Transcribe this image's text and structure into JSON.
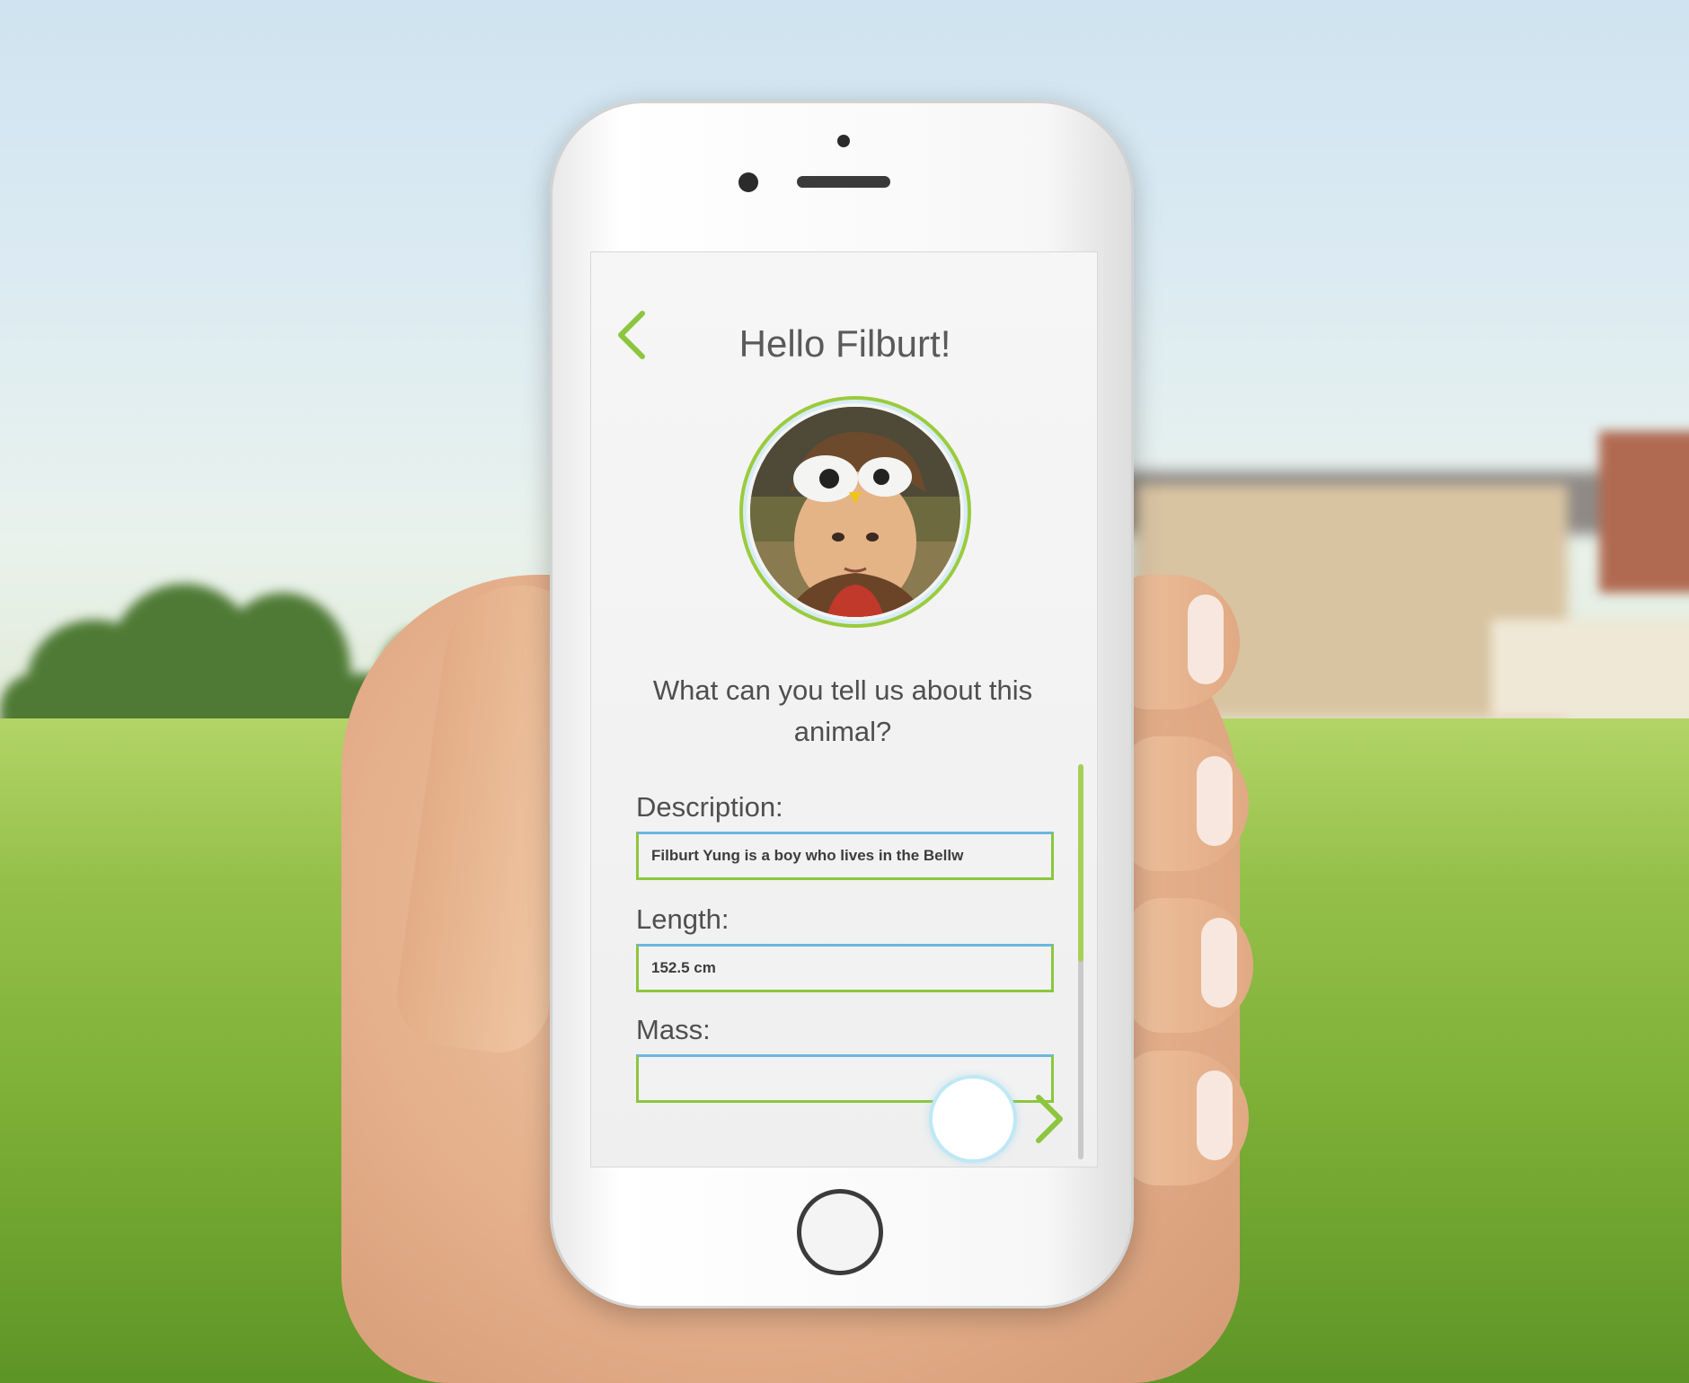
{
  "screen": {
    "title": "Hello Filburt!",
    "question": "What can you tell us about this animal?",
    "fields": [
      {
        "label": "Description:",
        "value": "Filburt Yung is a boy who lives in the Bellw"
      },
      {
        "label": "Length:",
        "value": "152.5 cm"
      },
      {
        "label": "Mass:",
        "value": ""
      }
    ]
  },
  "icons": {
    "back": "chevron-left-icon",
    "next": "chevron-right-icon"
  },
  "colors": {
    "accent_green": "#8cc63f",
    "accent_blue": "#6ab7e0",
    "text": "#4f4f4f"
  }
}
